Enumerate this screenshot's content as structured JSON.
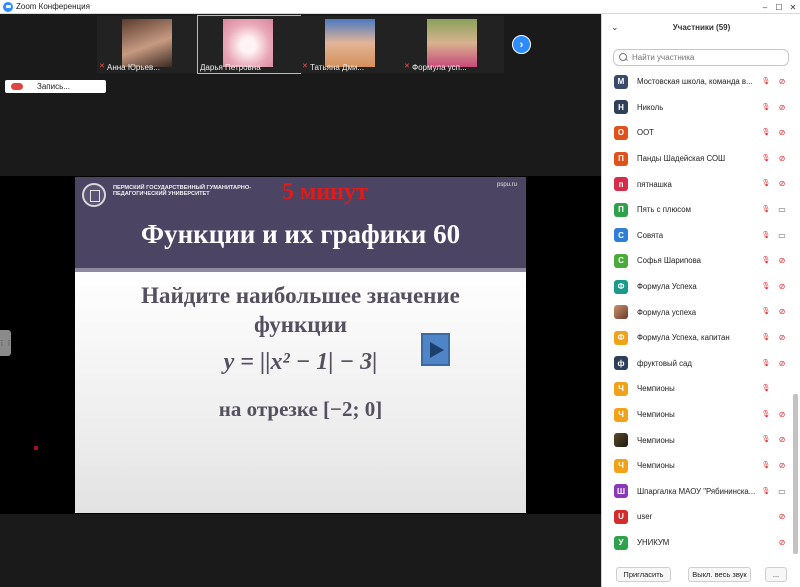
{
  "window": {
    "title": "Zoom Конференция",
    "minimize": "–",
    "maximize": "☐",
    "close": "✕"
  },
  "thumbnails": [
    {
      "name": "Анна Юрьев...",
      "muted": true,
      "color": "#7a5a4a"
    },
    {
      "name": "Дарья Петровна",
      "muted": false,
      "color": "#e7b7c4"
    },
    {
      "name": "Татьяна Дми...",
      "muted": true,
      "color": "#4a6ea8"
    },
    {
      "name": "Формула усп...",
      "muted": true,
      "color": "#7b8a4a"
    }
  ],
  "next_page_icon": "chevron-right-icon",
  "recording": {
    "label": "Запись..."
  },
  "slide": {
    "university": "Пермский государственный гуманитарно-педагогический университет",
    "timer": "5 минут",
    "site": "pspu.ru",
    "title": "Функции и их графики 60",
    "line1": "Найдите наибольшее значение",
    "line2": "функции",
    "formula": "y = ||x² − 1| − 3|",
    "interval": "на отрезке [−2; 0]"
  },
  "panel": {
    "title": "Участники (59)",
    "search_placeholder": "Найти участника",
    "participants": [
      {
        "initial": "М",
        "name": "Мостовская школа, команда в...",
        "color": "#3a4a6b",
        "mic": "off",
        "cam": "off"
      },
      {
        "initial": "Н",
        "name": "Николь",
        "color": "#2f3f5a",
        "mic": "off",
        "cam": "off"
      },
      {
        "initial": "О",
        "name": "ООТ",
        "color": "#e0521b",
        "mic": "off",
        "cam": "off"
      },
      {
        "initial": "П",
        "name": "Панды Шадейская СОШ",
        "color": "#e0521b",
        "mic": "off",
        "cam": "off"
      },
      {
        "initial": "п",
        "name": "пятнашка",
        "color": "#d42c4a",
        "mic": "off",
        "cam": "off"
      },
      {
        "initial": "П",
        "name": "Пять с плюсом",
        "color": "#2ea24b",
        "mic": "off",
        "cam": "on"
      },
      {
        "initial": "С",
        "name": "Совята",
        "color": "#2f7fd6",
        "mic": "off",
        "cam": "on"
      },
      {
        "initial": "С",
        "name": "Софья Шарипова",
        "color": "#4caa3a",
        "mic": "off",
        "cam": "off"
      },
      {
        "initial": "Ф",
        "name": "Формула Успеха",
        "color": "#1a9a8c",
        "mic": "off",
        "cam": "off"
      },
      {
        "initial": "",
        "name": "Формула успеха",
        "color": "photo",
        "mic": "off",
        "cam": "off"
      },
      {
        "initial": "Ф",
        "name": "Формула Успеха, капитан",
        "color": "#f0a21a",
        "mic": "off",
        "cam": "off"
      },
      {
        "initial": "ф",
        "name": "фруктовый сад",
        "color": "#2f3f5a",
        "mic": "off",
        "cam": "off"
      },
      {
        "initial": "Ч",
        "name": "Чемпионы",
        "color": "#f0a21a",
        "mic": "off",
        "cam": "none"
      },
      {
        "initial": "Ч",
        "name": "Чемпионы",
        "color": "#f0a21a",
        "mic": "off",
        "cam": "off"
      },
      {
        "initial": "",
        "name": "Чемпионы",
        "color": "photo2",
        "mic": "off",
        "cam": "off"
      },
      {
        "initial": "Ч",
        "name": "Чемпионы",
        "color": "#f0a21a",
        "mic": "off",
        "cam": "off"
      },
      {
        "initial": "Ш",
        "name": "Шпаргалка МАОУ \"Рябининска...",
        "color": "#8a3ab8",
        "mic": "off",
        "cam": "on"
      },
      {
        "initial": "U",
        "name": "user",
        "color": "#d42c2c",
        "mic": "none",
        "cam": "off"
      },
      {
        "initial": "У",
        "name": "УНИКУМ",
        "color": "#2ea24b",
        "mic": "none",
        "cam": "off"
      }
    ],
    "invite_label": "Пригласить",
    "mute_all_label": "Выкл. весь звук",
    "more_label": "..."
  }
}
